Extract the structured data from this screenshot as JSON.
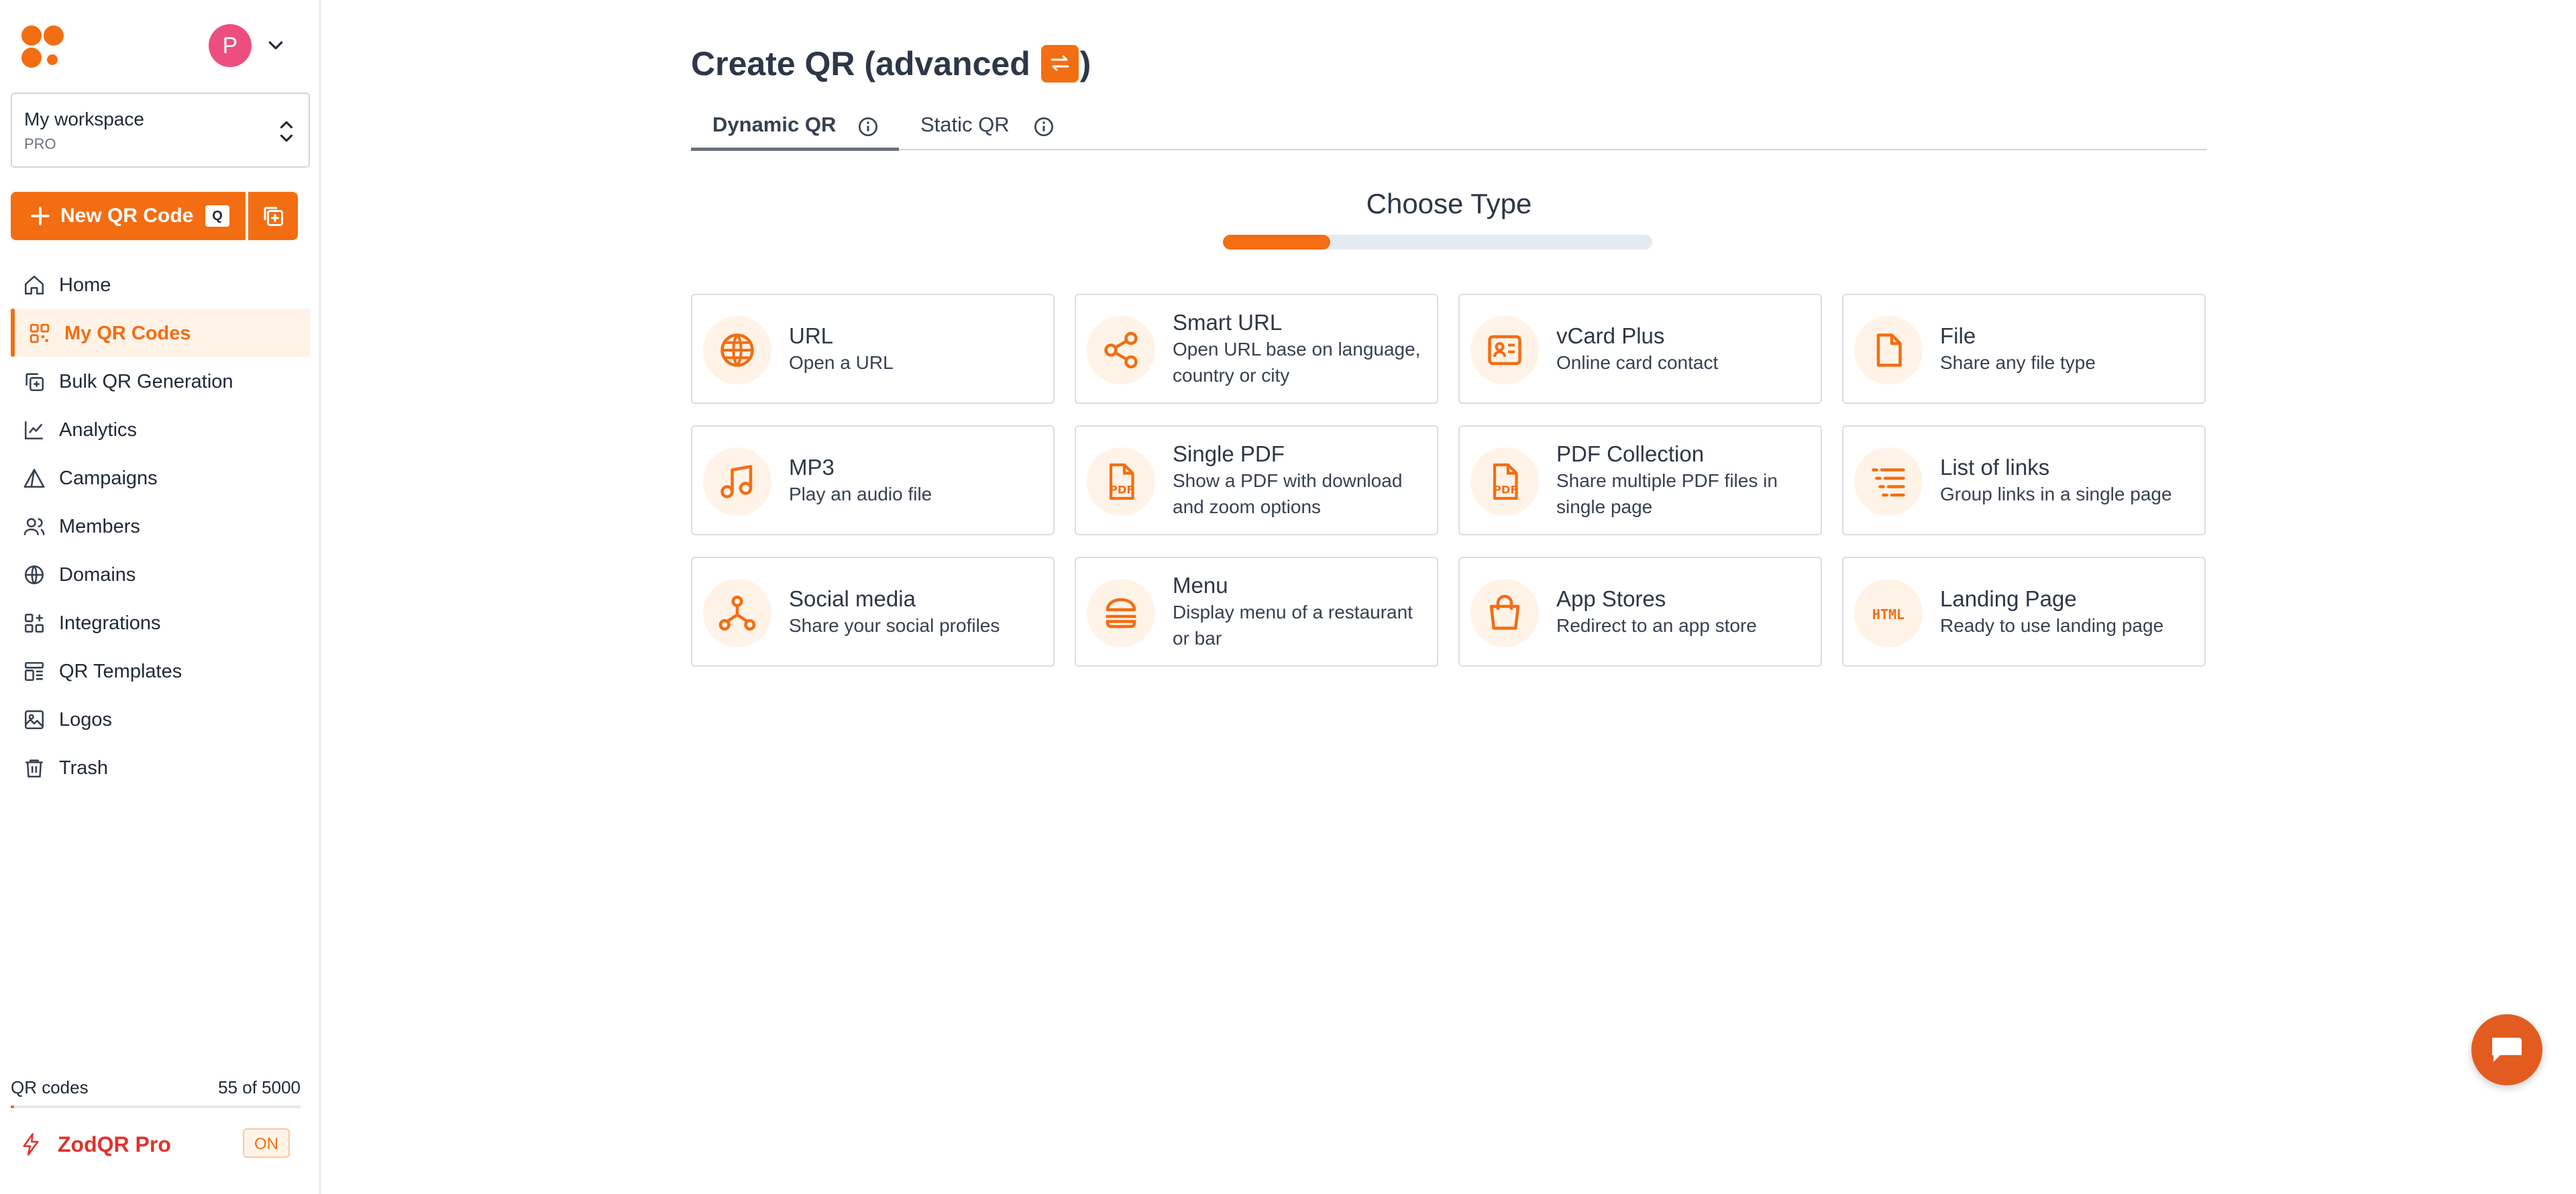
{
  "sidebar": {
    "avatar_initial": "P",
    "workspace": {
      "name": "My workspace",
      "plan": "PRO"
    },
    "new_qr": {
      "label": "New QR Code",
      "shortcut": "Q"
    },
    "items": [
      {
        "label": "Home",
        "icon": "home-icon",
        "active": false
      },
      {
        "label": "My QR Codes",
        "icon": "qr-grid-icon",
        "active": true
      },
      {
        "label": "Bulk QR Generation",
        "icon": "bulk-copy-icon",
        "active": false
      },
      {
        "label": "Analytics",
        "icon": "analytics-icon",
        "active": false
      },
      {
        "label": "Campaigns",
        "icon": "campaign-icon",
        "active": false
      },
      {
        "label": "Members",
        "icon": "members-icon",
        "active": false
      },
      {
        "label": "Domains",
        "icon": "globe-icon",
        "active": false
      },
      {
        "label": "Integrations",
        "icon": "integrations-icon",
        "active": false
      },
      {
        "label": "QR Templates",
        "icon": "templates-icon",
        "active": false
      },
      {
        "label": "Logos",
        "icon": "image-icon",
        "active": false
      },
      {
        "label": "Trash",
        "icon": "trash-icon",
        "active": false
      }
    ],
    "qr_count": {
      "label": "QR codes",
      "value": "55 of 5000",
      "fraction": 0.011
    },
    "pro": {
      "label": "ZodQR Pro",
      "badge": "ON"
    }
  },
  "main": {
    "title_prefix": "Create QR (advanced ",
    "title_suffix": ")",
    "tabs": [
      {
        "label": "Dynamic QR",
        "active": true
      },
      {
        "label": "Static QR",
        "active": false
      }
    ],
    "step_title": "Choose Type",
    "step_progress": 0.25,
    "types": [
      {
        "title": "URL",
        "desc": "Open a URL",
        "icon": "globe-icon"
      },
      {
        "title": "Smart URL",
        "desc": "Open URL base on language, country or city",
        "icon": "share-icon"
      },
      {
        "title": "vCard Plus",
        "desc": "Online card contact",
        "icon": "contact-card-icon"
      },
      {
        "title": "File",
        "desc": "Share any file type",
        "icon": "file-icon"
      },
      {
        "title": "MP3",
        "desc": "Play an audio file",
        "icon": "music-note-icon"
      },
      {
        "title": "Single PDF",
        "desc": "Show a PDF with download and zoom options",
        "icon": "pdf-icon"
      },
      {
        "title": "PDF Collection",
        "desc": "Share multiple PDF files in single page",
        "icon": "pdf-icon"
      },
      {
        "title": "List of links",
        "desc": "Group links in a single page",
        "icon": "list-icon"
      },
      {
        "title": "Social media",
        "desc": "Share your social profiles",
        "icon": "social-icon"
      },
      {
        "title": "Menu",
        "desc": "Display menu of a restaurant or bar",
        "icon": "burger-icon"
      },
      {
        "title": "App Stores",
        "desc": "Redirect to an app store",
        "icon": "shopping-bag-icon"
      },
      {
        "title": "Landing Page",
        "desc": "Ready to use landing page",
        "icon": "html-icon"
      }
    ]
  },
  "colors": {
    "accent": "#f36d12",
    "accent_light": "#fff3e8",
    "pro_red": "#e0322b",
    "avatar": "#ec4f7f"
  }
}
